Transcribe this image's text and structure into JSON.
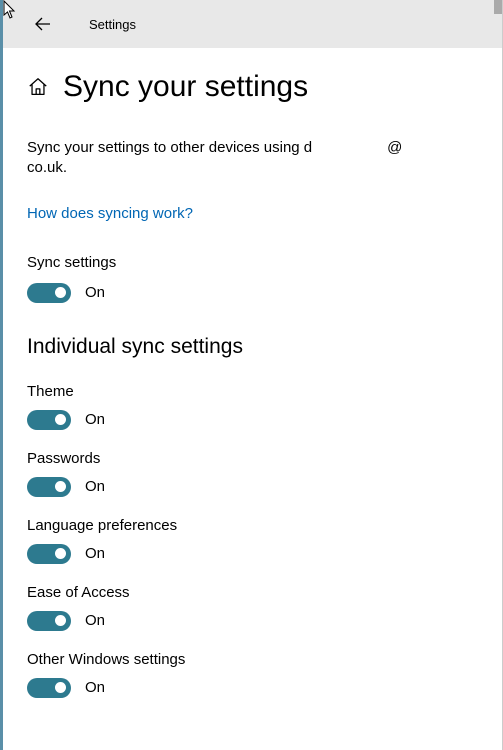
{
  "header": {
    "app_title": "Settings"
  },
  "page": {
    "title": "Sync your settings",
    "description_prefix": "Sync your settings to other devices using d",
    "description_at": "@",
    "description_domain": "co.uk.",
    "help_link": "How does syncing work?"
  },
  "main_toggle": {
    "label": "Sync settings",
    "state": "On"
  },
  "subsection": {
    "title": "Individual sync settings"
  },
  "settings": [
    {
      "label": "Theme",
      "state": "On"
    },
    {
      "label": "Passwords",
      "state": "On"
    },
    {
      "label": "Language preferences",
      "state": "On"
    },
    {
      "label": "Ease of Access",
      "state": "On"
    },
    {
      "label": "Other Windows settings",
      "state": "On"
    }
  ]
}
